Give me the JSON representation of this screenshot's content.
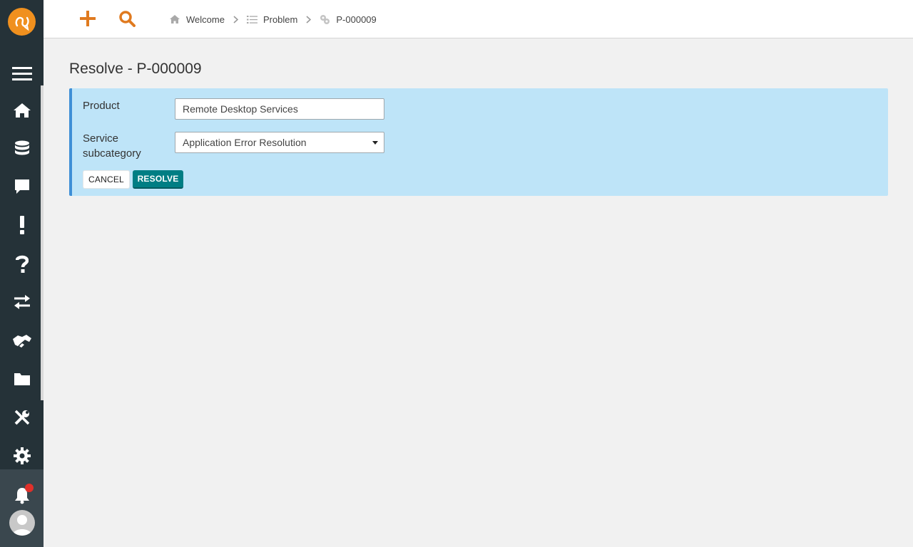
{
  "sidebar": {
    "items": [
      {
        "name": "menu"
      },
      {
        "name": "home"
      },
      {
        "name": "database"
      },
      {
        "name": "chat"
      },
      {
        "name": "incident"
      },
      {
        "name": "help"
      },
      {
        "name": "exchange"
      },
      {
        "name": "handshake"
      },
      {
        "name": "folder"
      },
      {
        "name": "tools"
      },
      {
        "name": "settings"
      }
    ],
    "has_notification": true
  },
  "toolbar": {
    "accent_color": "#e07a1f"
  },
  "breadcrumb": [
    {
      "label": "Welcome",
      "icon": "home-icon"
    },
    {
      "label": "Problem",
      "icon": "list-icon"
    },
    {
      "label": "P-000009",
      "icon": "problem-icon"
    }
  ],
  "page": {
    "title": "Resolve - P-000009"
  },
  "form": {
    "product_label": "Product",
    "product_value": "Remote Desktop Services",
    "subcategory_label_line1": "Service",
    "subcategory_label_line2": "subcategory",
    "subcategory_value": "Application Error Resolution",
    "cancel_label": "CANCEL",
    "resolve_label": "RESOLVE"
  },
  "colors": {
    "sidebar": "#253238",
    "panel": "#bee4f8",
    "panel_border": "#3e8fd6",
    "resolve_button": "#007e84",
    "logo": "#f0901e"
  }
}
